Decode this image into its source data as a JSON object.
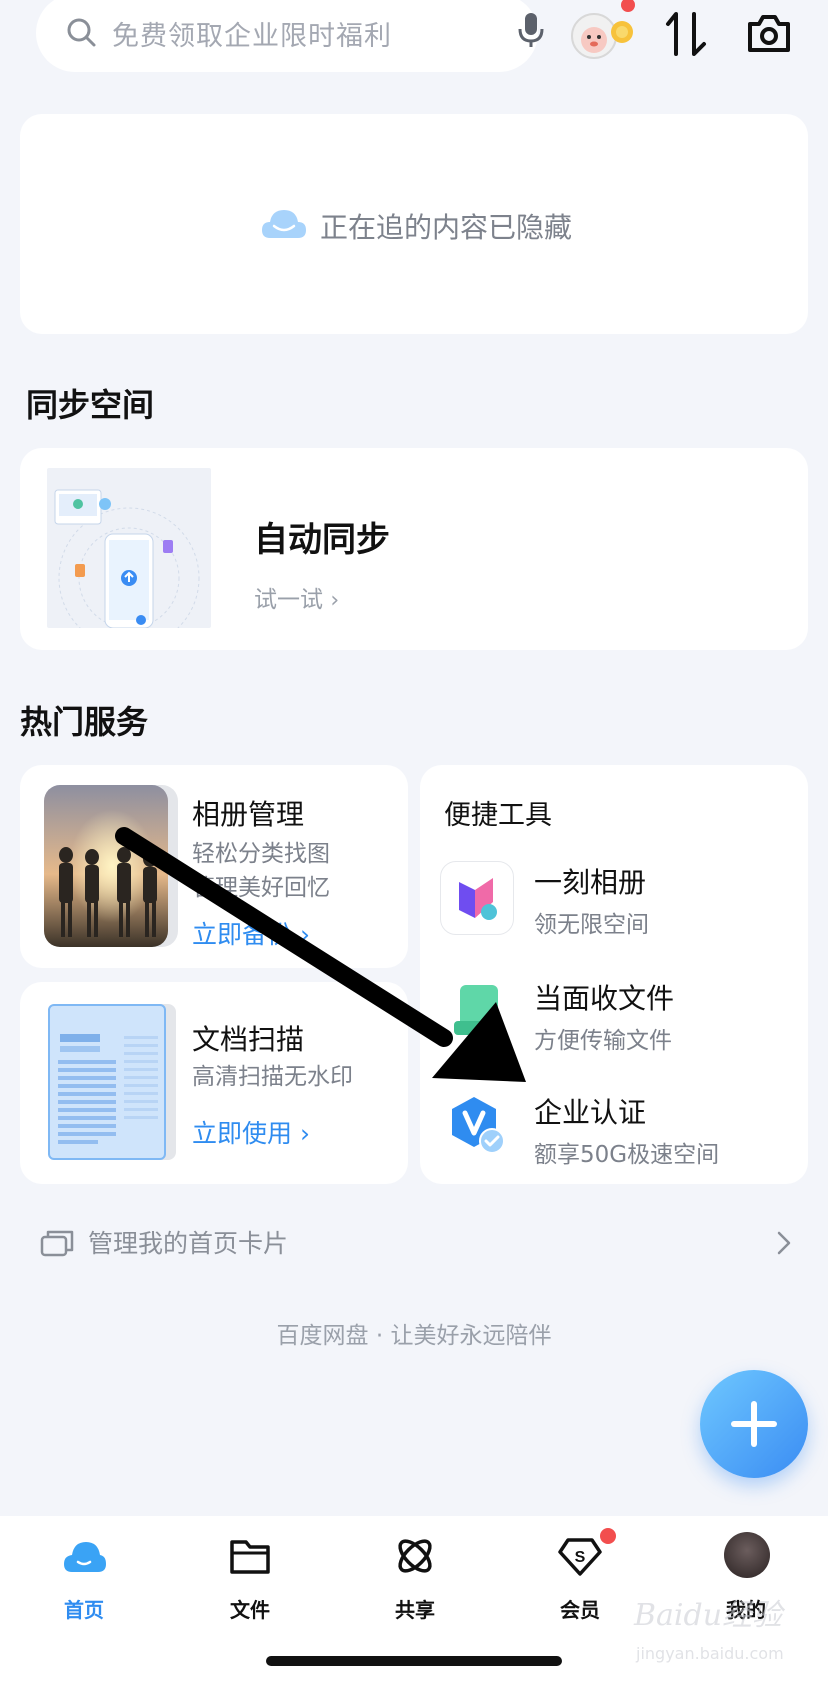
{
  "header": {
    "search_placeholder": "免费领取企业限时福利",
    "icons": [
      "search-icon",
      "microphone-icon",
      "mascot-icon",
      "transfer-icon",
      "camera-icon"
    ]
  },
  "hidden_card": {
    "text": "正在追的内容已隐藏"
  },
  "sync_section": {
    "title": "同步空间",
    "card_title": "自动同步",
    "card_action": "试一试"
  },
  "services_section": {
    "title": "热门服务",
    "album": {
      "title": "相册管理",
      "subtitle_1": "轻松分类找图",
      "subtitle_2": "管理美好回忆",
      "link": "立即备份"
    },
    "scan": {
      "title": "文档扫描",
      "subtitle": "高清扫描无水印",
      "link": "立即使用"
    },
    "tools": {
      "title": "便捷工具",
      "items": [
        {
          "name": "一刻相册",
          "desc": "领无限空间"
        },
        {
          "name": "当面收文件",
          "desc": "方便传输文件"
        },
        {
          "name": "企业认证",
          "desc": "额享50G极速空间"
        }
      ]
    }
  },
  "manage_cards": {
    "label": "管理我的首页卡片"
  },
  "slogan": "百度网盘 · 让美好永远陪伴",
  "bottom_nav": {
    "items": [
      {
        "label": "首页",
        "icon": "cloud-home-icon",
        "active": true
      },
      {
        "label": "文件",
        "icon": "folder-icon",
        "active": false
      },
      {
        "label": "共享",
        "icon": "share-atom-icon",
        "active": false
      },
      {
        "label": "会员",
        "icon": "vip-diamond-icon",
        "active": false
      },
      {
        "label": "我的",
        "icon": "avatar-icon",
        "active": false
      }
    ]
  },
  "watermark": {
    "text": "Baidu经验",
    "url": "jingyan.baidu.com"
  },
  "colors": {
    "accent": "#2f8cf0",
    "background": "#f3f5fa",
    "badge": "#f24e4e"
  }
}
